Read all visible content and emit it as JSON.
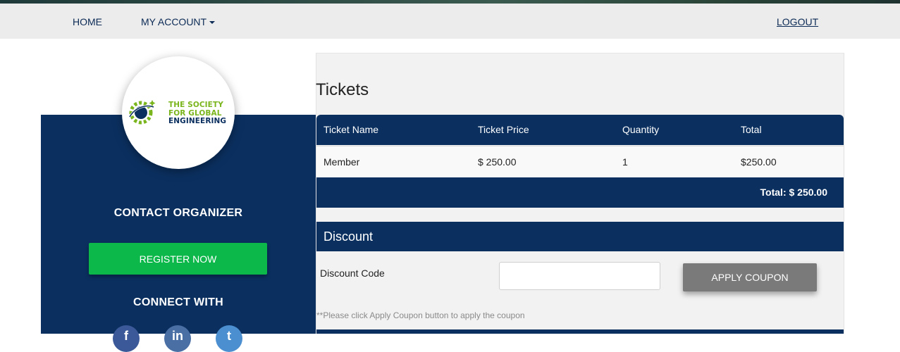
{
  "nav": {
    "home": "HOME",
    "my_account": "MY ACCOUNT",
    "logout": "LOGOUT"
  },
  "sidebar": {
    "logo": {
      "line1": "THE SOCIETY",
      "line2": "FOR GLOBAL",
      "line3": "ENGINEERING",
      "icon": "gear-globe-logo-icon"
    },
    "contact_title": "CONTACT ORGANIZER",
    "register_label": "REGISTER NOW",
    "connect_title": "CONNECT WITH",
    "social": [
      {
        "name": "facebook-icon",
        "glyph": "f"
      },
      {
        "name": "linkedin-icon",
        "glyph": "in"
      },
      {
        "name": "twitter-icon",
        "glyph": "t"
      }
    ]
  },
  "tickets": {
    "title": "Tickets",
    "columns": [
      "Ticket Name",
      "Ticket Price",
      "Quantity",
      "Total"
    ],
    "rows": [
      {
        "name": "Member",
        "price": "$ 250.00",
        "quantity": "1",
        "total": "$250.00"
      }
    ],
    "total_label": "Total: $ 250.00"
  },
  "discount": {
    "title": "Discount",
    "code_label": "Discount Code",
    "code_value": "",
    "apply_label": "APPLY COUPON",
    "hint": "**Please click Apply Coupon button to apply the coupon"
  },
  "colors": {
    "navy": "#0b3060",
    "green_button": "#0cb84a",
    "grey_button": "#7a7a7a",
    "logo_green": "#7ab51d"
  }
}
